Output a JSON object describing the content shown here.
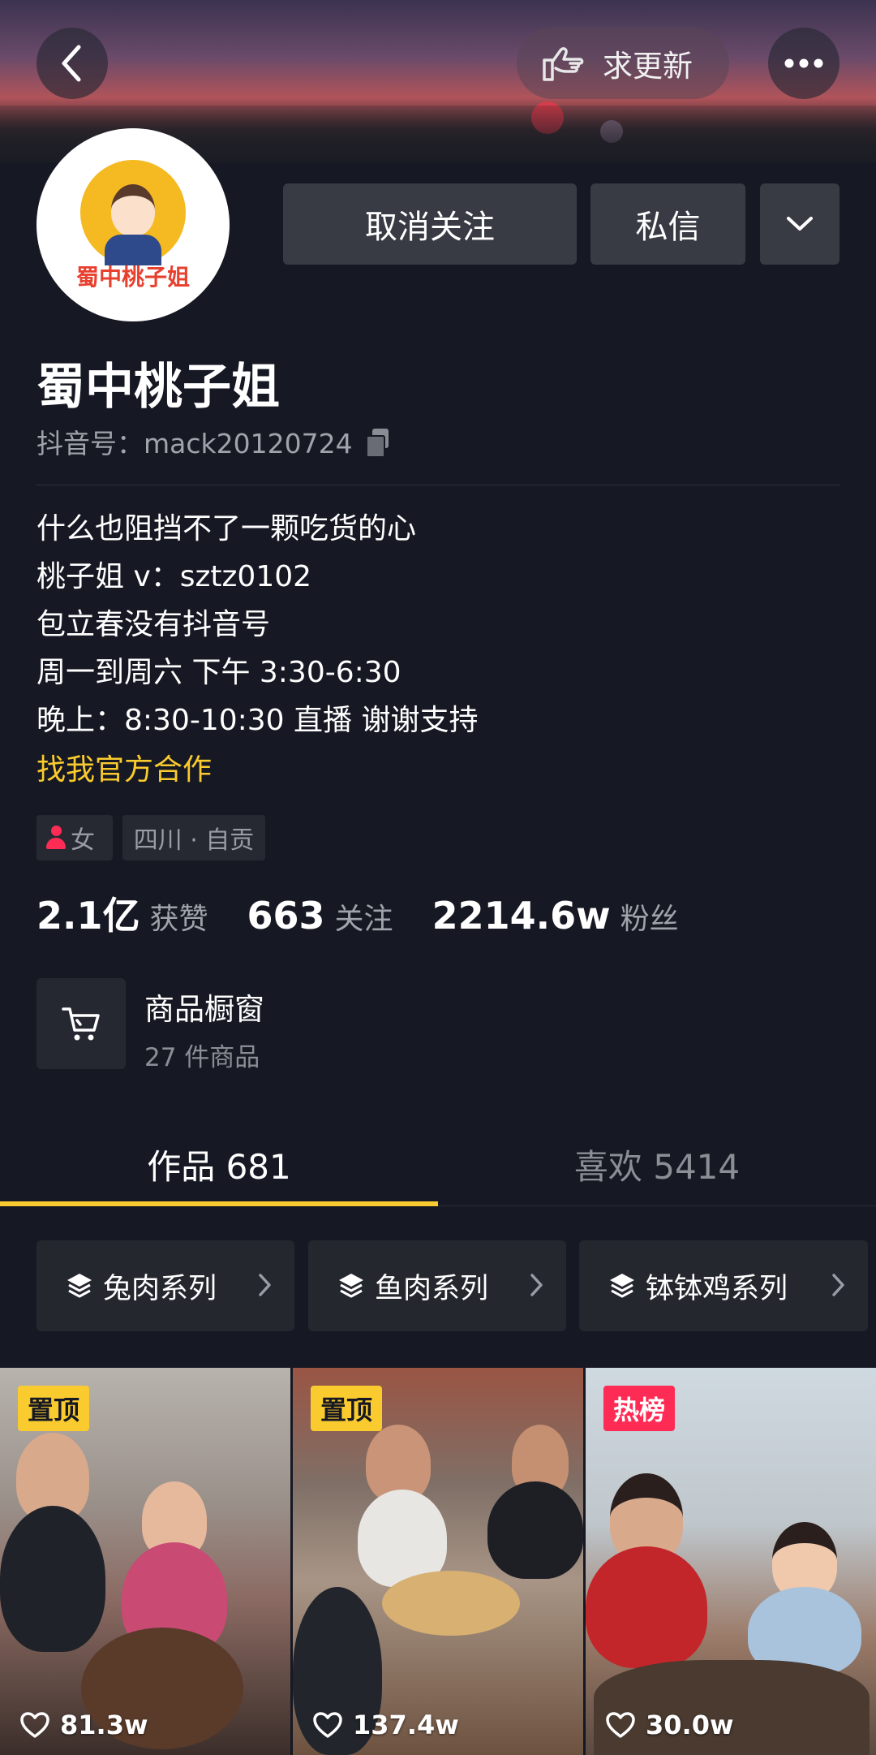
{
  "header": {
    "update_label": "求更新",
    "icons": {
      "back": "chevron-left-icon",
      "update": "pointing-hand-icon",
      "more": "more-dots-icon"
    }
  },
  "avatar": {
    "brand_text": "蜀中桃子姐"
  },
  "actions": {
    "unfollow_label": "取消关注",
    "message_label": "私信",
    "dropdown_icon": "chevron-down-icon"
  },
  "profile": {
    "name": "蜀中桃子姐",
    "douyin_id": "抖音号：mack20120724",
    "bio_lines": [
      "什么也阻挡不了一颗吃货的心",
      "桃子姐 v：sztz0102",
      "包立春没有抖音号",
      "周一到周六 下午 3:30-6:30",
      "晚上：8:30-10:30 直播 谢谢支持"
    ],
    "bio_link": "找我官方合作",
    "tags": {
      "gender": "女",
      "location": "四川 · 自贡"
    }
  },
  "stats": [
    {
      "value": "2.1亿",
      "label": "获赞"
    },
    {
      "value": "663",
      "label": "关注"
    },
    {
      "value": "2214.6w",
      "label": "粉丝"
    }
  ],
  "shop": {
    "title": "商品橱窗",
    "subtitle": "27 件商品",
    "icon": "shopping-cart-icon"
  },
  "tabs": [
    {
      "label": "作品 681",
      "active": true
    },
    {
      "label": "喜欢 5414",
      "active": false
    }
  ],
  "collections": [
    {
      "label": "兔肉系列"
    },
    {
      "label": "鱼肉系列"
    },
    {
      "label": "钵钵鸡系列"
    }
  ],
  "videos": [
    {
      "badge": "置顶",
      "likes": "81.3w"
    },
    {
      "badge": "置顶",
      "likes": "137.4w"
    },
    {
      "badge": "热榜",
      "likes": "30.0w"
    }
  ],
  "colors": {
    "background": "#161823",
    "accent_yellow": "#facb2f",
    "accent_red": "#fe2c55",
    "button_gray": "#393b44"
  }
}
